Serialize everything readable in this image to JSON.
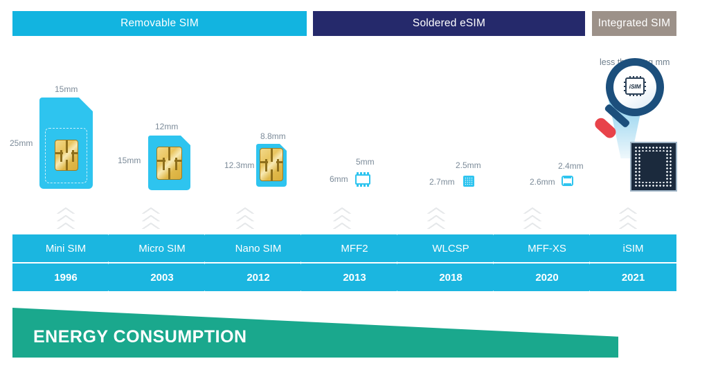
{
  "categories": [
    {
      "label": "Removable SIM",
      "color": "#12b4e0"
    },
    {
      "label": "Soldered eSIM",
      "color": "#25296b"
    },
    {
      "label": "Integrated SIM",
      "color": "#9c9189"
    }
  ],
  "form_factors": [
    {
      "name": "Mini SIM",
      "width": "15mm",
      "height": "25mm",
      "year": "1996"
    },
    {
      "name": "Micro SIM",
      "width": "12mm",
      "height": "15mm",
      "year": "2003"
    },
    {
      "name": "Nano SIM",
      "width": "8.8mm",
      "height": "12.3mm",
      "year": "2012"
    },
    {
      "name": "MFF2",
      "width": "5mm",
      "height": "6mm",
      "year": "2013"
    },
    {
      "name": "WLCSP",
      "width": "2.5mm",
      "height": "2.7mm",
      "year": "2018"
    },
    {
      "name": "MFF-XS",
      "width": "2.4mm",
      "height": "2.6mm",
      "year": "2020"
    },
    {
      "name": "iSIM",
      "width": "",
      "height": "",
      "year": "2021"
    }
  ],
  "isim": {
    "caption": "less than 1 sq mm",
    "chip_label": "iSIM"
  },
  "energy": {
    "label": "ENERGY CONSUMPTION",
    "color": "#1aa88d"
  },
  "colors": {
    "cyan": "#1bb6e0",
    "sim_body": "#2ec4ef",
    "navy": "#25296b",
    "taupe": "#9c9189",
    "green": "#1aa88d",
    "dim_text": "#7c8b99"
  }
}
